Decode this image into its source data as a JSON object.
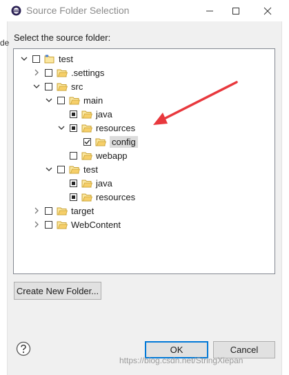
{
  "window": {
    "title": "Source Folder Selection",
    "left_edge_fragment": "de",
    "colors": {
      "arrow": "#e8383d",
      "title_text": "#8a8a8a",
      "default_border": "#0078d7"
    }
  },
  "dialog": {
    "prompt": "Select the source folder:",
    "tree": [
      {
        "label": "test",
        "icon": "project-icon",
        "expanded": true,
        "check": "unchecked"
      },
      {
        "label": ".settings",
        "icon": "folder-icon",
        "expanded": false,
        "check": "unchecked"
      },
      {
        "label": "src",
        "icon": "folder-icon",
        "expanded": true,
        "check": "unchecked"
      },
      {
        "label": "main",
        "icon": "folder-icon",
        "expanded": true,
        "check": "unchecked"
      },
      {
        "label": "java",
        "icon": "folder-icon",
        "expanded": null,
        "check": "partial"
      },
      {
        "label": "resources",
        "icon": "folder-icon",
        "expanded": true,
        "check": "partial"
      },
      {
        "label": "config",
        "icon": "folder-icon",
        "expanded": null,
        "check": "checked",
        "selected": true
      },
      {
        "label": "webapp",
        "icon": "folder-icon",
        "expanded": null,
        "check": "unchecked"
      },
      {
        "label": "test",
        "icon": "folder-icon",
        "expanded": true,
        "check": "unchecked"
      },
      {
        "label": "java",
        "icon": "folder-icon",
        "expanded": null,
        "check": "partial"
      },
      {
        "label": "resources",
        "icon": "folder-icon",
        "expanded": null,
        "check": "partial"
      },
      {
        "label": "target",
        "icon": "folder-icon",
        "expanded": false,
        "check": "unchecked"
      },
      {
        "label": "WebContent",
        "icon": "folder-icon",
        "expanded": false,
        "check": "unchecked"
      }
    ],
    "create_folder_label": "Create New Folder...",
    "ok_label": "OK",
    "cancel_label": "Cancel"
  },
  "watermark": "https://blog.csdn.net/StringXiepan"
}
